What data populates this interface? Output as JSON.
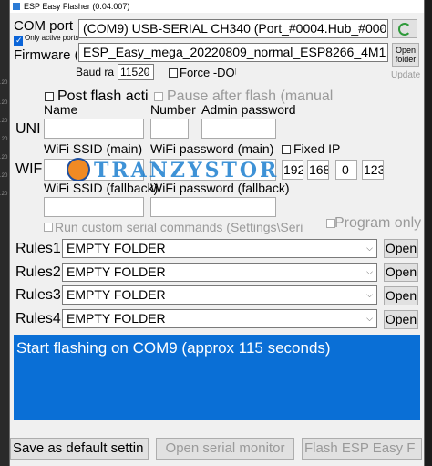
{
  "window": {
    "title": "ESP Easy Flasher (0.04.007)"
  },
  "com_port": {
    "label": "COM port",
    "value": "(COM9) USB-SERIAL CH340 (Port_#0004.Hub_#000",
    "only_active_label": "Only active ports",
    "only_active_checked": true
  },
  "firmware": {
    "label": "Firmware (.",
    "value": "ESP_Easy_mega_20220809_normal_ESP8266_4M1",
    "open_folder_label": "Open folder"
  },
  "baud": {
    "label": "Baud ra",
    "value": "11520",
    "force_dout_label": "Force -DOU",
    "update_label": "Update"
  },
  "options": {
    "post_flash_label": "Post flash acti",
    "pause_after_label": "Pause after flash (manual"
  },
  "unit": {
    "label": "UNI",
    "name_label": "Name",
    "number_label": "Number",
    "admin_label": "Admin password"
  },
  "wifi": {
    "label": "WIF",
    "ssid_main_label": "WiFi SSID (main)",
    "password_main_label": "WiFi password (main)",
    "fixed_ip_label": "Fixed IP",
    "ssid_fallback_label": "WiFi SSID (fallback)",
    "password_fallback_label": "WiFi password (fallback)",
    "ip_octets": [
      "192",
      "168",
      "0",
      "123"
    ]
  },
  "serial": {
    "run_custom_label": "Run custom serial commands (Settings\\Seria",
    "program_only_label": "Program only"
  },
  "rules": [
    {
      "label": "Rules1",
      "value": "EMPTY FOLDER",
      "open_label": "Open"
    },
    {
      "label": "Rules2",
      "value": "EMPTY FOLDER",
      "open_label": "Open"
    },
    {
      "label": "Rules3",
      "value": "EMPTY FOLDER",
      "open_label": "Open"
    },
    {
      "label": "Rules4",
      "value": "EMPTY FOLDER",
      "open_label": "Open"
    }
  ],
  "log": {
    "text": "Start flashing on COM9 (approx 115 seconds)"
  },
  "footer": {
    "save_default_label": "Save as default settin",
    "open_monitor_label": "Open serial monitor",
    "flash_label": "Flash ESP Easy F"
  },
  "watermark": {
    "text": "TRANZYSTOR"
  },
  "colors": {
    "log_bg": "#0a6fd6",
    "refresh_icon": "#2e9a3a",
    "checkbox_on": "#0a64d8"
  }
}
